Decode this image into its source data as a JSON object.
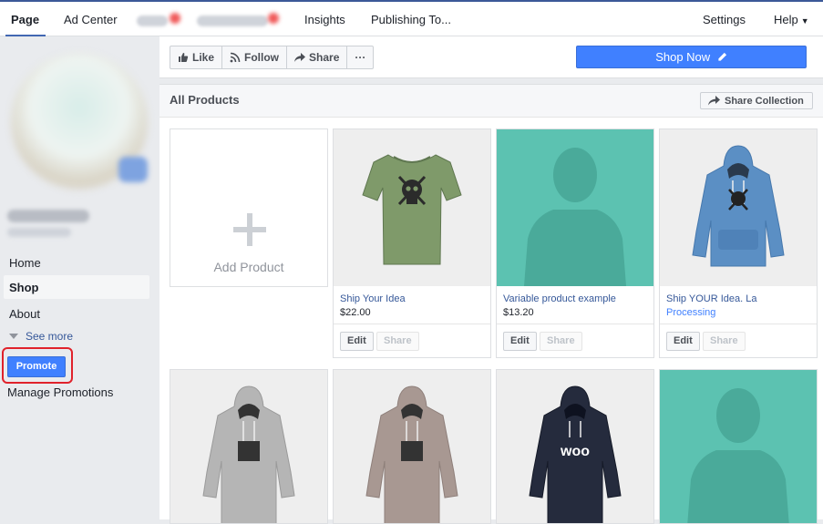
{
  "topnav": {
    "items": [
      "Page",
      "Ad Center",
      "Insights",
      "Publishing To..."
    ],
    "settings": "Settings",
    "help": "Help"
  },
  "sidebar": {
    "items": [
      "Home",
      "Shop",
      "About"
    ],
    "see_more": "See more",
    "promote": "Promote",
    "manage_promotions": "Manage Promotions"
  },
  "actions": {
    "like": "Like",
    "follow": "Follow",
    "share": "Share",
    "more": "···",
    "shop_now": "Shop Now"
  },
  "catalog": {
    "title": "All Products",
    "share_collection": "Share Collection",
    "add_product": "Add Product",
    "edit_label": "Edit",
    "share_label": "Share",
    "products": [
      {
        "title": "Ship Your Idea",
        "price": "$22.00"
      },
      {
        "title": "Variable product example",
        "price": "$13.20"
      },
      {
        "title": "Ship YOUR Idea. La",
        "price": "Processing"
      }
    ],
    "hoodie_text": "woo"
  },
  "colors": {
    "brand": "#4267b2",
    "primary_button": "#4080ff",
    "link": "#365899",
    "highlight_ring": "#e0222b",
    "tshirt_green": "#7f9a6a",
    "hoodie_blue": "#5b8fc4",
    "hoodie_grey": "#b5b5b5",
    "hoodie_taupe": "#a89892",
    "hoodie_navy": "#252b3d",
    "placeholder_teal": "#5cc2b1"
  }
}
